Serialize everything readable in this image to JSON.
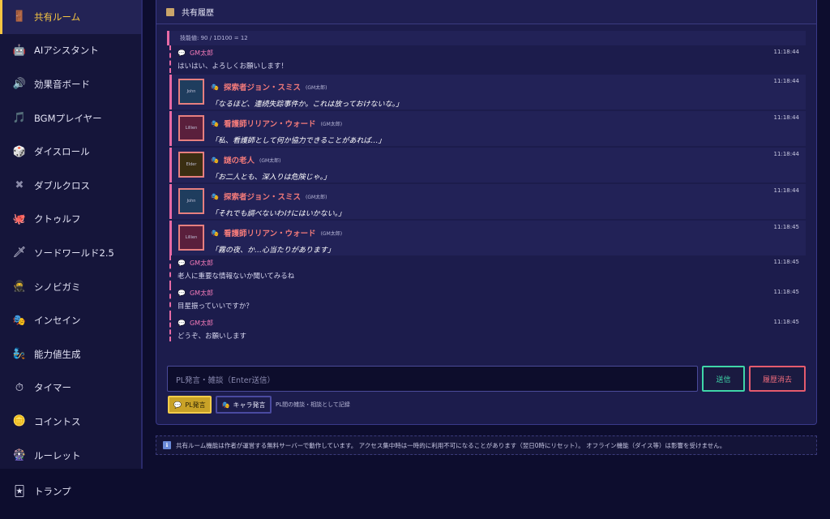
{
  "sidebar": {
    "items": [
      {
        "label": "共有ルーム",
        "icon": "door-icon",
        "glyph": "🚪"
      },
      {
        "label": "AIアシスタント",
        "icon": "robot-icon",
        "glyph": "🤖"
      },
      {
        "label": "効果音ボード",
        "icon": "speaker-icon",
        "glyph": "🔊"
      },
      {
        "label": "BGMプレイヤー",
        "icon": "music-note-icon",
        "glyph": "🎵"
      },
      {
        "label": "ダイスロール",
        "icon": "dice-icon",
        "glyph": "🎲"
      },
      {
        "label": "ダブルクロス",
        "icon": "cross-icon",
        "glyph": "✖"
      },
      {
        "label": "クトゥルフ",
        "icon": "octopus-icon",
        "glyph": "🐙"
      },
      {
        "label": "ソードワールド2.5",
        "icon": "sword-icon",
        "glyph": "🗡"
      },
      {
        "label": "シノビガミ",
        "icon": "ninja-icon",
        "glyph": "🥷"
      },
      {
        "label": "インセイン",
        "icon": "theater-mask-icon",
        "glyph": "🎭"
      },
      {
        "label": "能力値生成",
        "icon": "genie-icon",
        "glyph": "🧞"
      },
      {
        "label": "タイマー",
        "icon": "stopwatch-icon",
        "glyph": "⏱"
      },
      {
        "label": "コイントス",
        "icon": "coin-icon",
        "glyph": "🪙"
      },
      {
        "label": "ルーレット",
        "icon": "roulette-icon",
        "glyph": "🎡"
      }
    ],
    "bottom": {
      "label": "トランプ",
      "icon": "playing-card-icon",
      "glyph": "🃏"
    }
  },
  "panel": {
    "title": "共有履歴",
    "previous_line": "技能値: 90 / 1D100 = 12",
    "messages": [
      {
        "kind": "gm",
        "name": "GM太郎",
        "text": "はいはい、よろしくお願いします！",
        "time": "11:18:44"
      },
      {
        "kind": "chara",
        "avatar": "John",
        "name": "探索者ジョン・スミス",
        "by": "(GM太郎)",
        "text": "「なるほど、連続失踪事件か。これは放っておけないな。」",
        "time": "11:18:44"
      },
      {
        "kind": "chara",
        "avatar": "Lillien",
        "name": "看護師リリアン・ウォード",
        "by": "(GM太郎)",
        "text": "「私、看護師として何か協力できることがあれば…」",
        "time": "11:18:44"
      },
      {
        "kind": "chara",
        "avatar": "Elder",
        "name": "謎の老人",
        "by": "(GM太郎)",
        "text": "「お二人とも、深入りは危険じゃ。」",
        "time": "11:18:44"
      },
      {
        "kind": "chara",
        "avatar": "John",
        "name": "探索者ジョン・スミス",
        "by": "(GM太郎)",
        "text": "「それでも調べないわけにはいかない。」",
        "time": "11:18:44"
      },
      {
        "kind": "chara",
        "avatar": "Lillien",
        "name": "看護師リリアン・ウォード",
        "by": "(GM太郎)",
        "text": "「霧の夜、か…心当たりがあります」",
        "time": "11:18:45"
      },
      {
        "kind": "gm",
        "name": "GM太郎",
        "text": "老人に重要な情報ないか聞いてみるね",
        "time": "11:18:45"
      },
      {
        "kind": "gm",
        "name": "GM太郎",
        "text": "目星振っていいですか？",
        "time": "11:18:45"
      },
      {
        "kind": "gm",
        "name": "GM太郎",
        "text": "どうぞ、お願いします",
        "time": "11:18:45"
      }
    ],
    "input_placeholder": "PL発言・雑談（Enter送信）",
    "send_label": "送信",
    "clear_label": "履歴消去",
    "mode_pl_label": "PL発言",
    "mode_chara_label": "キャラ発言",
    "mode_note": "PL間の雑談・相談として記録"
  },
  "notice": "共有ルーム機能は作者が運営する無料サーバーで動作しています。 アクセス集中時は一時的に利用不可になることがあります（翌日0時にリセット）。 オフライン機能（ダイス等）は影響を受けません。",
  "colors": {
    "accent": "#f5c542",
    "gm_name": "#f27ab8",
    "chara_name": "#f27a7a",
    "send": "#3fd6a8",
    "clear": "#e55b6e"
  }
}
